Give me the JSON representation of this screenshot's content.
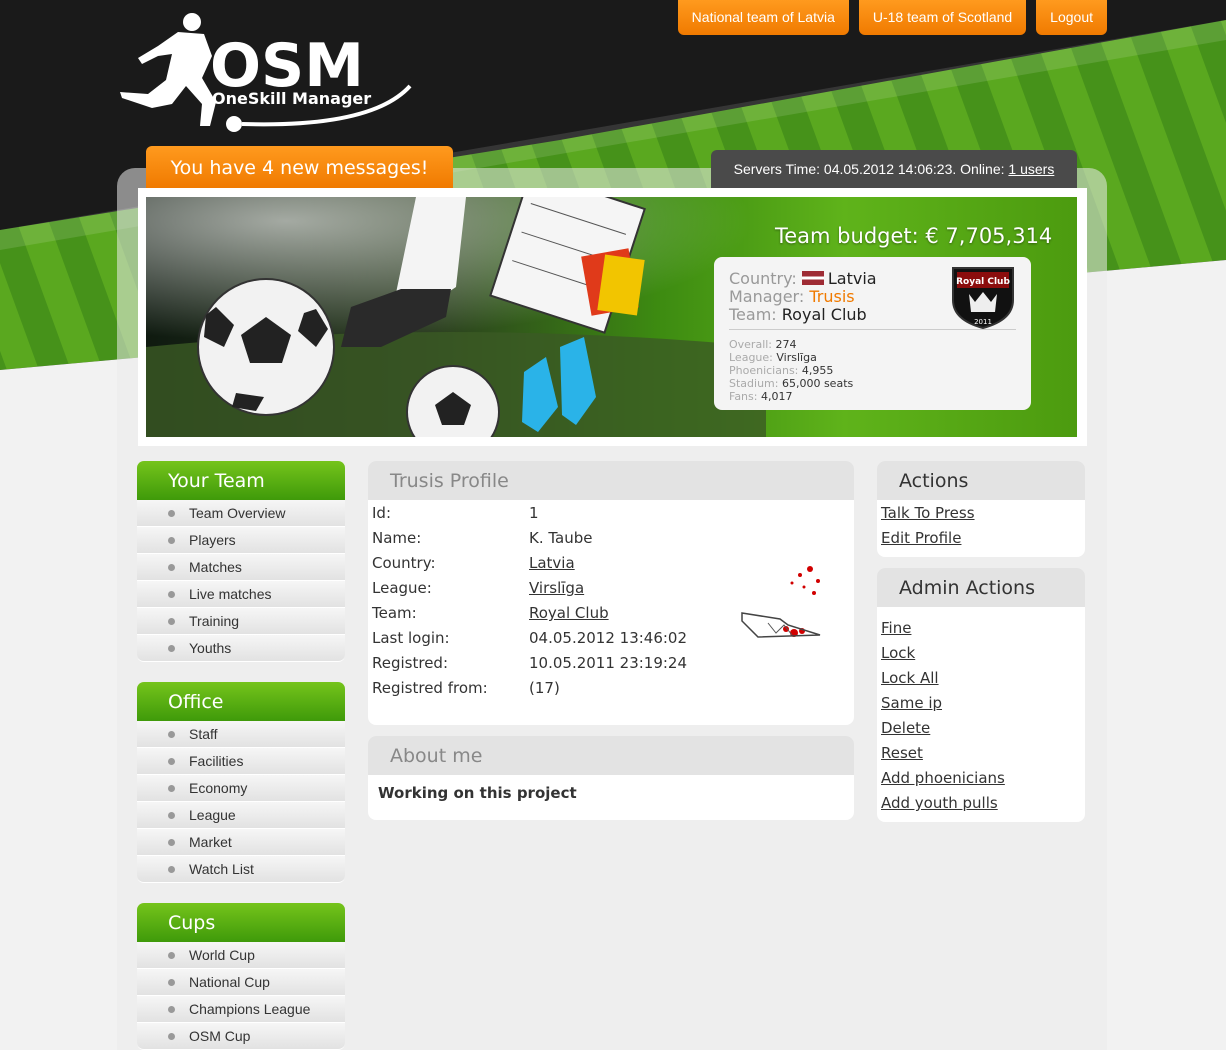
{
  "app": {
    "logo_title": "OSM",
    "logo_subtitle": "OneSkill Manager"
  },
  "top_nav": [
    {
      "label": "National team of Latvia"
    },
    {
      "label": "U-18 team of Scotland"
    },
    {
      "label": "Logout"
    }
  ],
  "messages": {
    "label": "You have 4 new messages!"
  },
  "server": {
    "prefix": "Servers Time: 04.05.2012 14:06:23. Online: ",
    "online_link": "1 users"
  },
  "banner": {
    "budget": "Team budget: € 7,705,314",
    "country_label": "Country:",
    "country_value": "Latvia",
    "manager_label": "Manager:",
    "manager_value": "Trusis",
    "team_label": "Team:",
    "team_value": "Royal Club",
    "crest_name": "Royal Club",
    "crest_year": "2011",
    "stats": [
      {
        "label": "Overall:",
        "value": "274"
      },
      {
        "label": "League:",
        "value": "Virslīga"
      },
      {
        "label": "Phoenicians:",
        "value": "4,955"
      },
      {
        "label": "Stadium:",
        "value": "65,000 seats"
      },
      {
        "label": "Fans:",
        "value": "4,017"
      }
    ]
  },
  "menus": {
    "your_team": {
      "title": "Your Team",
      "items": [
        "Team Overview",
        "Players",
        "Matches",
        "Live matches",
        "Training",
        "Youths"
      ]
    },
    "office": {
      "title": "Office",
      "items": [
        "Staff",
        "Facilities",
        "Economy",
        "League",
        "Market",
        "Watch List"
      ]
    },
    "cups": {
      "title": "Cups",
      "items": [
        "World Cup",
        "National Cup",
        "Champions League",
        "OSM Cup"
      ]
    }
  },
  "profile": {
    "title": "Trusis Profile",
    "rows": [
      {
        "label": "Id:",
        "value": "1"
      },
      {
        "label": "Name:",
        "value": "K. Taube"
      },
      {
        "label": "Country:",
        "value": "Latvia"
      },
      {
        "label": "League:",
        "value": "Virslīga"
      },
      {
        "label": "Team:",
        "value": "Royal Club"
      },
      {
        "label": "Last login:",
        "value": "04.05.2012 13:46:02"
      },
      {
        "label": "Registred:",
        "value": "10.05.2011 23:19:24"
      },
      {
        "label": "Registred from:",
        "value": "(17)"
      }
    ]
  },
  "about": {
    "title": "About me",
    "text": "Working on this project"
  },
  "actions": {
    "title": "Actions",
    "links": [
      "Talk To Press",
      "Edit Profile"
    ]
  },
  "admin_actions": {
    "title": "Admin Actions",
    "links": [
      "Fine",
      "Lock",
      "Lock All",
      "Same ip",
      "Delete",
      "Reset",
      "Add phoenicians",
      "Add youth pulls"
    ]
  },
  "colors": {
    "orange": "#f07a00",
    "green": "#4fa80f",
    "dark": "#1a1a1a"
  }
}
